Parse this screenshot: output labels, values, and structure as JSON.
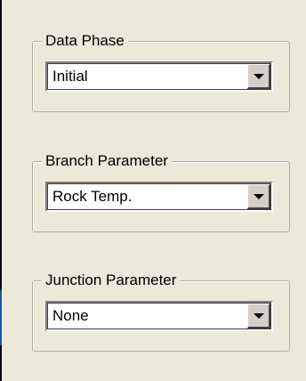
{
  "groups": [
    {
      "label": "Data Phase",
      "value": "Initial"
    },
    {
      "label": "Branch Parameter",
      "value": "Rock Temp."
    },
    {
      "label": "Junction Parameter",
      "value": "None"
    }
  ],
  "colors": {
    "background": "#ece9d8",
    "window_border": "#000000",
    "group_border": "#b0ad9e",
    "field_background": "#ffffff",
    "button_face": "#d4d0c8",
    "left_accent": "#1f4fa0"
  },
  "icons": {
    "dropdown": "chevron-down-icon"
  }
}
